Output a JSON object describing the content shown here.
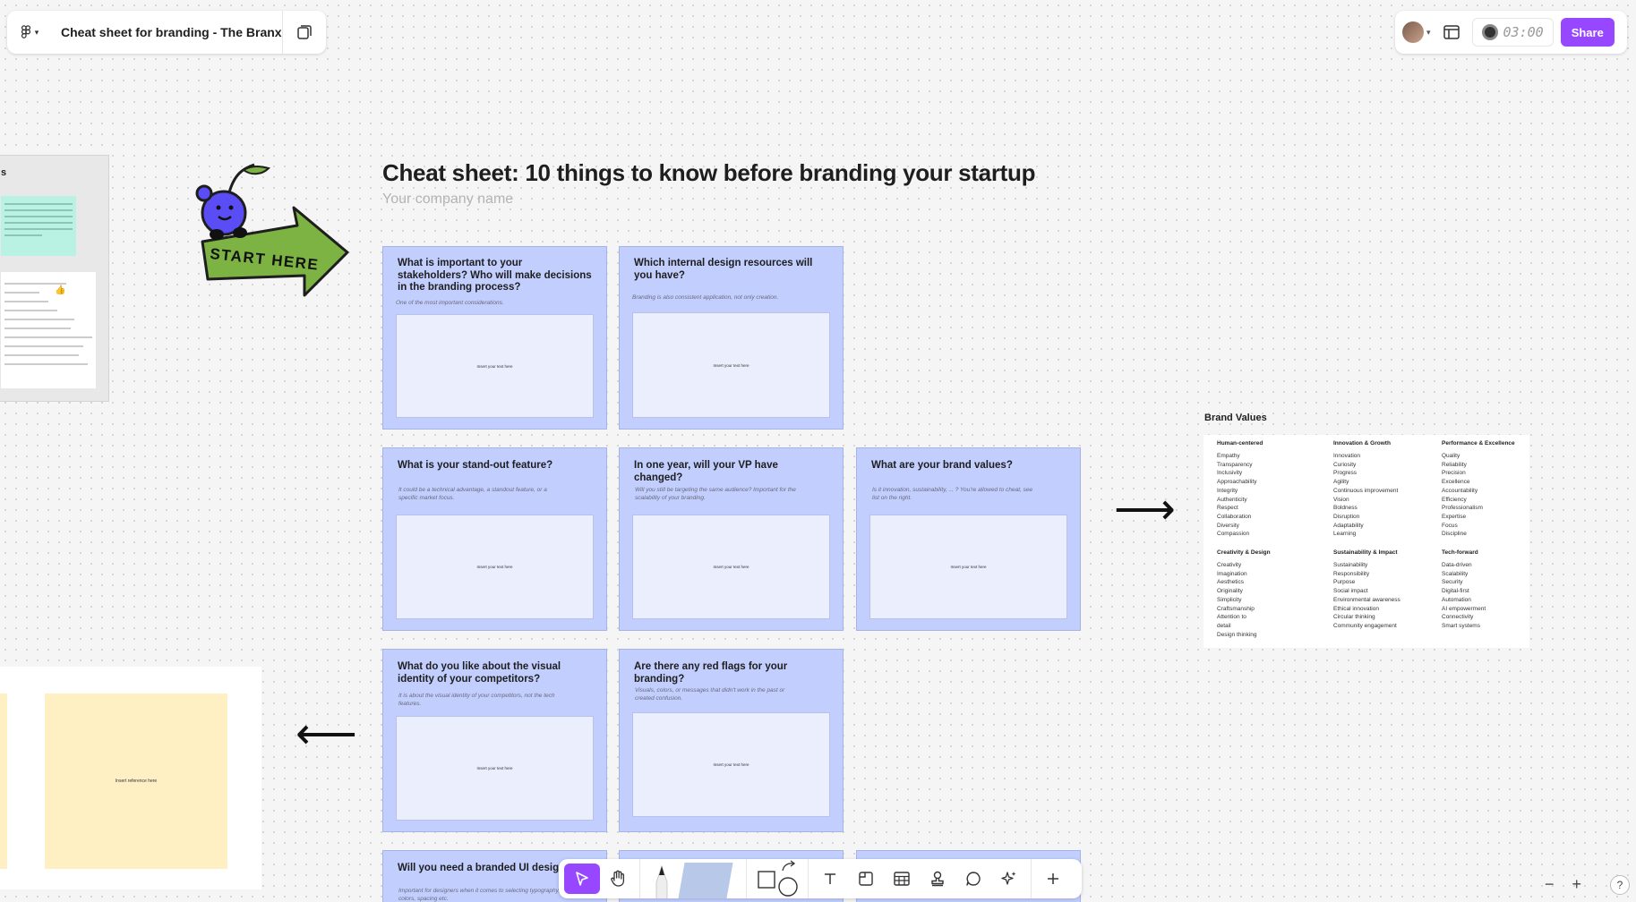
{
  "file": {
    "title": "Cheat sheet for branding - The Branx"
  },
  "header_right": {
    "timer": "03:00",
    "share_label": "Share"
  },
  "board": {
    "title": "Cheat sheet: 10 things to know before branding your startup",
    "company_placeholder": "Your company name",
    "sticker_text": "START HERE",
    "left_frame_title": "s",
    "reference_placeholder": "Insert reference here"
  },
  "cards": [
    {
      "question": "What is important to your stakeholders? Who will make decisions in the branding process?",
      "hint": "One of the most important considerations.",
      "box": "Insert your text here"
    },
    {
      "question": "Which internal design resources will you have?",
      "hint": "Branding is also consistent application, not only creation.",
      "box": "Insert your text here"
    },
    {
      "question": "What is your stand-out feature?",
      "hint": "It could be a technical advantage, a standout feature, or a specific market focus.",
      "box": "Insert your text here"
    },
    {
      "question": "In one year, will your VP have changed?",
      "hint": "Will you still be targeting the same audience? Important for the scalability of your branding.",
      "box": "Insert your text here"
    },
    {
      "question": "What are your brand values?",
      "hint": "Is it innovation, sustainability, ... ? You're allowed to cheat, see list on the right.",
      "box": "Insert your text here"
    },
    {
      "question": "What do you like about the visual identity of your competitors?",
      "hint": "It is about the visual identity of your competitors, not the tech features.",
      "box": "Insert your text here"
    },
    {
      "question": "Are there any red flags for your branding?",
      "hint": "Visuals, colors, or messages that didn't work in the past or created confusion.",
      "box": "Insert your text here"
    },
    {
      "question": "Will you need a branded UI design s",
      "hint": "Important for designers when it comes to selecting typography, colors, spacing etc.",
      "box": ""
    }
  ],
  "brand_values": {
    "title": "Brand Values",
    "groups": [
      {
        "name": "Human-centered",
        "items": [
          "Empathy",
          "Transparency",
          "Inclusivity",
          "Approachability",
          "Integrity",
          "Authenticity",
          "Respect",
          "Collaboration",
          "Diversity",
          "Compassion"
        ]
      },
      {
        "name": "Innovation & Growth",
        "items": [
          "Innovation",
          "Curiosity",
          "Progress",
          "Agility",
          "Continuous improvement",
          "Vision",
          "Boldness",
          "Disruption",
          "Adaptability",
          "Learning"
        ]
      },
      {
        "name": "Performance & Excellence",
        "items": [
          "Quality",
          "Reliability",
          "Precision",
          "Excellence",
          "Accountability",
          "Efficiency",
          "Professionalism",
          "Expertise",
          "Focus",
          "Discipline"
        ]
      },
      {
        "name": "Creativity & Design",
        "items": [
          "Creativity",
          "Imagination",
          "Aesthetics",
          "Originality",
          "Simplicity",
          "Craftsmanship",
          "Attention to detail",
          "Design thinking"
        ]
      },
      {
        "name": "Sustainability & Impact",
        "items": [
          "Sustainability",
          "Responsibility",
          "Purpose",
          "Social impact",
          "Environmental awareness",
          "Ethical innovation",
          "Circular thinking",
          "Community engagement"
        ]
      },
      {
        "name": "Tech-forward",
        "items": [
          "Data-driven",
          "Scalability",
          "Security",
          "Digital-first",
          "Automation",
          "AI empowerment",
          "Connectivity",
          "Smart systems"
        ]
      }
    ]
  },
  "toolbar": {
    "items": [
      "move-tool",
      "hand-tool",
      "pen-tool",
      "marker-tool",
      "shape-tool",
      "text-tool",
      "section-tool",
      "table-tool",
      "stamp-tool",
      "comment-tool",
      "ai-tool",
      "more-tool"
    ]
  },
  "zoom": {
    "minus": "−",
    "plus": "+",
    "help": "?"
  },
  "colors": {
    "accent": "#9747ff",
    "card": "#c1cefe",
    "card_box": "#ebeffd",
    "sticky_yellow": "#fff0c4",
    "sticky_mint": "#b9f1e3"
  }
}
